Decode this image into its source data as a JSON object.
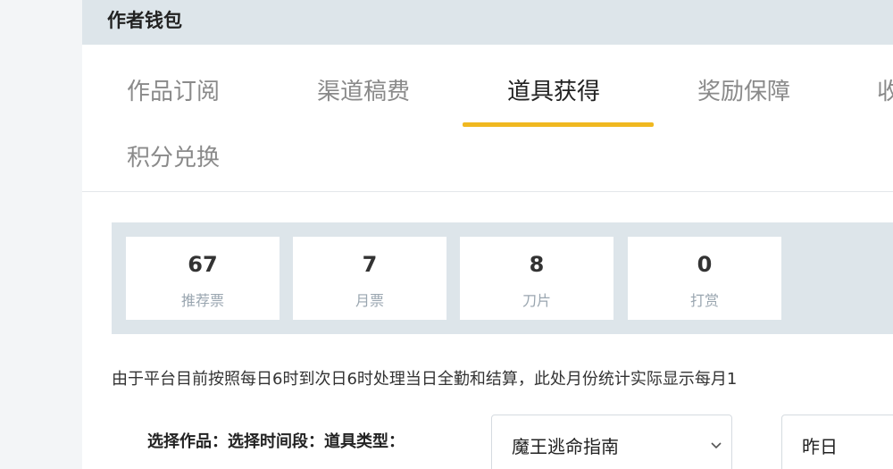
{
  "header": {
    "title": "作者钱包"
  },
  "tabs": [
    {
      "label": "作品订阅",
      "active": false
    },
    {
      "label": "渠道稿费",
      "active": false
    },
    {
      "label": "道具获得",
      "active": true
    },
    {
      "label": "奖励保障",
      "active": false
    },
    {
      "label": "收",
      "active": false
    },
    {
      "label": "积分兑换",
      "active": false
    }
  ],
  "stats": [
    {
      "value": "67",
      "label": "推荐票"
    },
    {
      "value": "7",
      "label": "月票"
    },
    {
      "value": "8",
      "label": "刀片"
    },
    {
      "value": "0",
      "label": "打赏"
    }
  ],
  "notice": "由于平台目前按照每日6时到次日6时处理当日全勤和结算，此处月份统计实际显示每月1",
  "filters": {
    "label": "选择作品：选择时间段：道具类型：",
    "work_select": {
      "value": "魔王逃命指南",
      "icon": "chevron-down-icon"
    },
    "time_select": {
      "value": "昨日"
    }
  },
  "colors": {
    "accent": "#f0b820",
    "header_bg": "#dde5ea"
  }
}
